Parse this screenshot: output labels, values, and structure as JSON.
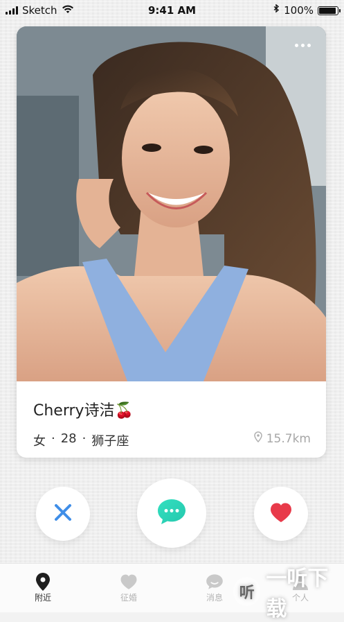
{
  "status_bar": {
    "carrier": "Sketch",
    "time": "9:41 AM",
    "battery": "100%",
    "battery_level": 1.0
  },
  "card": {
    "photo_icon": "person-selfie-photo",
    "name": "Cherry诗洁🍒",
    "meta": {
      "gender": "女",
      "sep1": "·",
      "age": "28",
      "sep2": "·",
      "zodiac": "狮子座"
    },
    "distance": "15.7km"
  },
  "actions": {
    "dislike_icon": "close-icon",
    "message_icon": "chat-bubble-icon",
    "like_icon": "heart-icon"
  },
  "tabs": [
    {
      "label": "附近",
      "icon": "location-pin-icon",
      "active": true
    },
    {
      "label": "征婚",
      "icon": "heart-icon",
      "active": false
    },
    {
      "label": "消息",
      "icon": "chat-icon",
      "active": false
    },
    {
      "label": "个人",
      "icon": "person-icon",
      "active": false
    }
  ],
  "watermark": {
    "logo": "听",
    "text": "一听下载"
  },
  "colors": {
    "accent_blue": "#3f8ee8",
    "accent_green": "#2fd3b8",
    "accent_red": "#e83a4a"
  }
}
